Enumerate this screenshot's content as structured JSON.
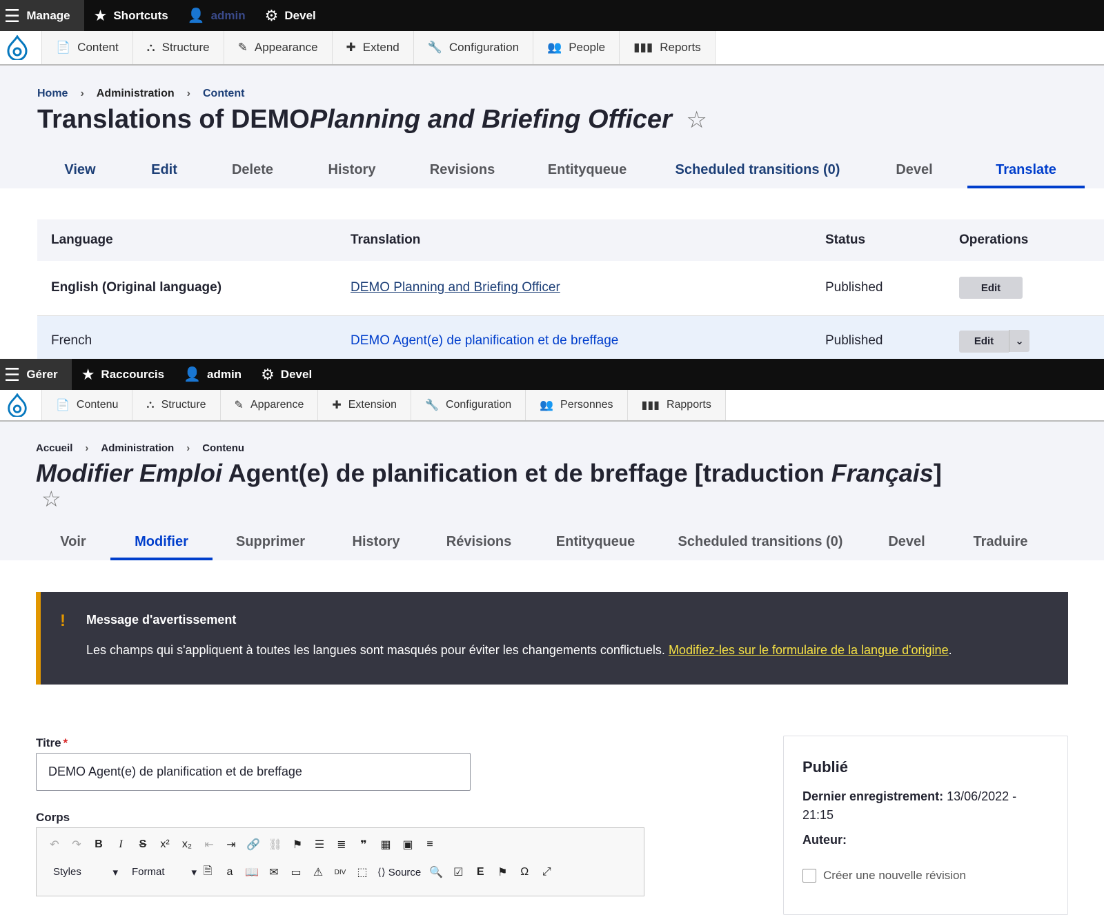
{
  "top": {
    "toolbar": {
      "manage": "Manage",
      "shortcuts": "Shortcuts",
      "user": "admin",
      "devel": "Devel"
    },
    "menu": [
      "Content",
      "Structure",
      "Appearance",
      "Extend",
      "Configuration",
      "People",
      "Reports"
    ],
    "breadcrumb": {
      "home": "Home",
      "admin": "Administration",
      "content": "Content",
      "sep": "›"
    },
    "title_prefix": "Translations of DEMO",
    "title_italic": "Planning and Briefing Officer",
    "star": "☆",
    "tabs": [
      "View",
      "Edit",
      "Delete",
      "History",
      "Revisions",
      "Entityqueue",
      "Scheduled transitions (0)",
      "Devel",
      "Translate"
    ],
    "table": {
      "headers": {
        "language": "Language",
        "translation": "Translation",
        "status": "Status",
        "operations": "Operations"
      },
      "rows": [
        {
          "language": "English (Original language)",
          "translation": "DEMO Planning and Briefing Officer",
          "status": "Published",
          "op": "Edit"
        },
        {
          "language": "French",
          "translation": "DEMO Agent(e) de planification et de breffage",
          "status": "Published",
          "op": "Edit"
        }
      ]
    }
  },
  "bottom": {
    "toolbar": {
      "manage": "Gérer",
      "shortcuts": "Raccourcis",
      "user": "admin",
      "devel": "Devel"
    },
    "menu": [
      "Contenu",
      "Structure",
      "Apparence",
      "Extension",
      "Configuration",
      "Personnes",
      "Rapports"
    ],
    "breadcrumb": {
      "home": "Accueil",
      "admin": "Administration",
      "content": "Contenu",
      "sep": "›"
    },
    "title_italic1": "Modifier Emploi",
    "title_mid": " Agent(e) de planification et de breffage [traduction ",
    "title_italic2": "Français",
    "title_end": "]",
    "star": "☆",
    "tabs": [
      "Voir",
      "Modifier",
      "Supprimer",
      "History",
      "Révisions",
      "Entityqueue",
      "Scheduled transitions (0)",
      "Devel",
      "Traduire"
    ],
    "warning": {
      "icon": "!",
      "title": "Message d'avertissement",
      "text": "Les champs qui s'appliquent à toutes les langues sont masqués pour éviter les changements conflictuels. ",
      "link": "Modifiez-les sur le formulaire de la langue d'origine",
      "end": "."
    },
    "form": {
      "title_label": "Titre",
      "required_mark": "*",
      "title_value": "DEMO Agent(e) de planification et de breffage",
      "body_label": "Corps",
      "styles": "Styles",
      "format": "Format",
      "source": "Source"
    },
    "sidebar": {
      "published": "Publié",
      "last_saved_label": "Dernier enregistrement:",
      "last_saved_value": " 13/06/2022 - 21:15",
      "author_label": "Auteur:",
      "new_revision": "Créer une nouvelle révision"
    }
  },
  "colors": {
    "accent": "#003ecc",
    "link": "#1d3f77",
    "warning_bg": "#353641",
    "warning_border": "#e29700",
    "warning_link": "#f6e244"
  }
}
